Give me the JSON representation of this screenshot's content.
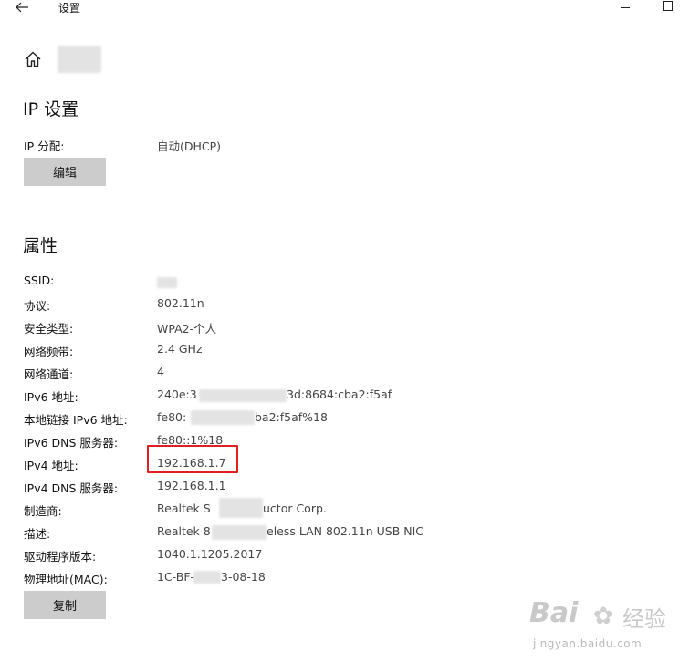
{
  "window": {
    "title": "设置",
    "back_icon": "arrow-left-icon",
    "min_icon": "minimize-icon",
    "max_icon": "maximize-icon"
  },
  "ip_settings": {
    "heading": "IP 设置",
    "assignment_label": "IP 分配:",
    "assignment_value": "自动(DHCP)",
    "edit_button": "编辑"
  },
  "properties": {
    "heading": "属性",
    "rows": [
      {
        "label": "SSID:",
        "value": ""
      },
      {
        "label": "协议:",
        "value": "802.11n"
      },
      {
        "label": "安全类型:",
        "value": "WPA2-个人"
      },
      {
        "label": "网络频带:",
        "value": "2.4 GHz"
      },
      {
        "label": "网络通道:",
        "value": "4"
      },
      {
        "label": "IPv6 地址:",
        "value_a": "240e:3",
        "value_b": "3d:8684:cba2:f5af"
      },
      {
        "label": "本地链接 IPv6 地址:",
        "value_a": "fe80:",
        "value_b": "ba2:f5af%18"
      },
      {
        "label": "IPv6 DNS 服务器:",
        "value": "fe80::1%18"
      },
      {
        "label": "IPv4 地址:",
        "value": "192.168.1.7"
      },
      {
        "label": "IPv4 DNS 服务器:",
        "value": "192.168.1.1"
      },
      {
        "label": "制造商:",
        "value_a": "Realtek S",
        "value_b": "uctor Corp."
      },
      {
        "label": "描述:",
        "value_a": "Realtek 8",
        "value_b": "eless LAN 802.11n USB NIC"
      },
      {
        "label": "驱动程序版本:",
        "value": "1040.1.1205.2017"
      },
      {
        "label": "物理地址(MAC):",
        "value_a": "1C-BF-",
        "value_b": "3-08-18"
      }
    ],
    "copy_button": "复制"
  },
  "watermark": {
    "brand": "Bai",
    "product": "经验",
    "url": "jingyan.baidu.com"
  },
  "colors": {
    "highlight": "#e02020",
    "button_bg": "#cccccc"
  }
}
